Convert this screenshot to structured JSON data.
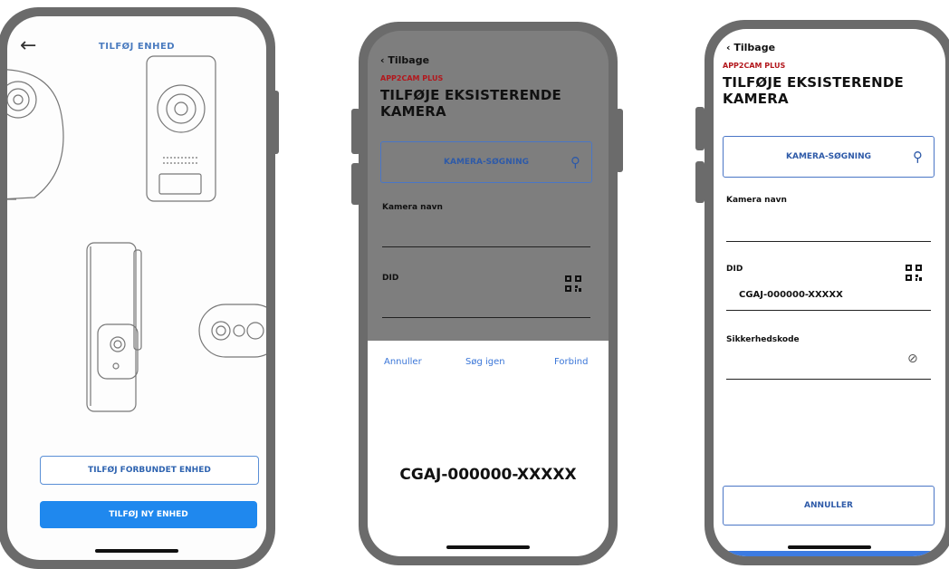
{
  "screen1": {
    "title": "TILFØJ ENHED",
    "back_icon": "←",
    "btn_connected": "TILFØJ FORBUNDET ENHED",
    "btn_new": "TILFØJ NY ENHED"
  },
  "screen2": {
    "back_label": "Tilbage",
    "brand": "APP2CAM PLUS",
    "heading_line1": "TILFØJE EKSISTERENDE",
    "heading_line2": "KAMERA",
    "search_label": "KAMERA-SØGNING",
    "search_icon": "⚲",
    "camera_name_label": "Kamera navn",
    "did_label": "DID",
    "action_cancel": "Annuller",
    "action_search_again": "Søg igen",
    "action_connect": "Forbind",
    "found_code": "CGAJ-000000-XXXXX"
  },
  "screen3": {
    "back_label": "Tilbage",
    "brand": "APP2CAM PLUS",
    "heading_line1": "TILFØJE EKSISTERENDE",
    "heading_line2": "KAMERA",
    "search_label": "KAMERA-SØGNING",
    "search_icon": "⚲",
    "camera_name_label": "Kamera navn",
    "did_label": "DID",
    "did_value": "CGAJ-000000-XXXXX",
    "security_label": "Sikkerhedskode",
    "eye_icon": "⊘",
    "cancel_button": "ANNULLER"
  },
  "colors": {
    "accent_blue": "#1f88ee",
    "brand_red": "#b3171c",
    "frame_gray": "#6b6b6b"
  }
}
